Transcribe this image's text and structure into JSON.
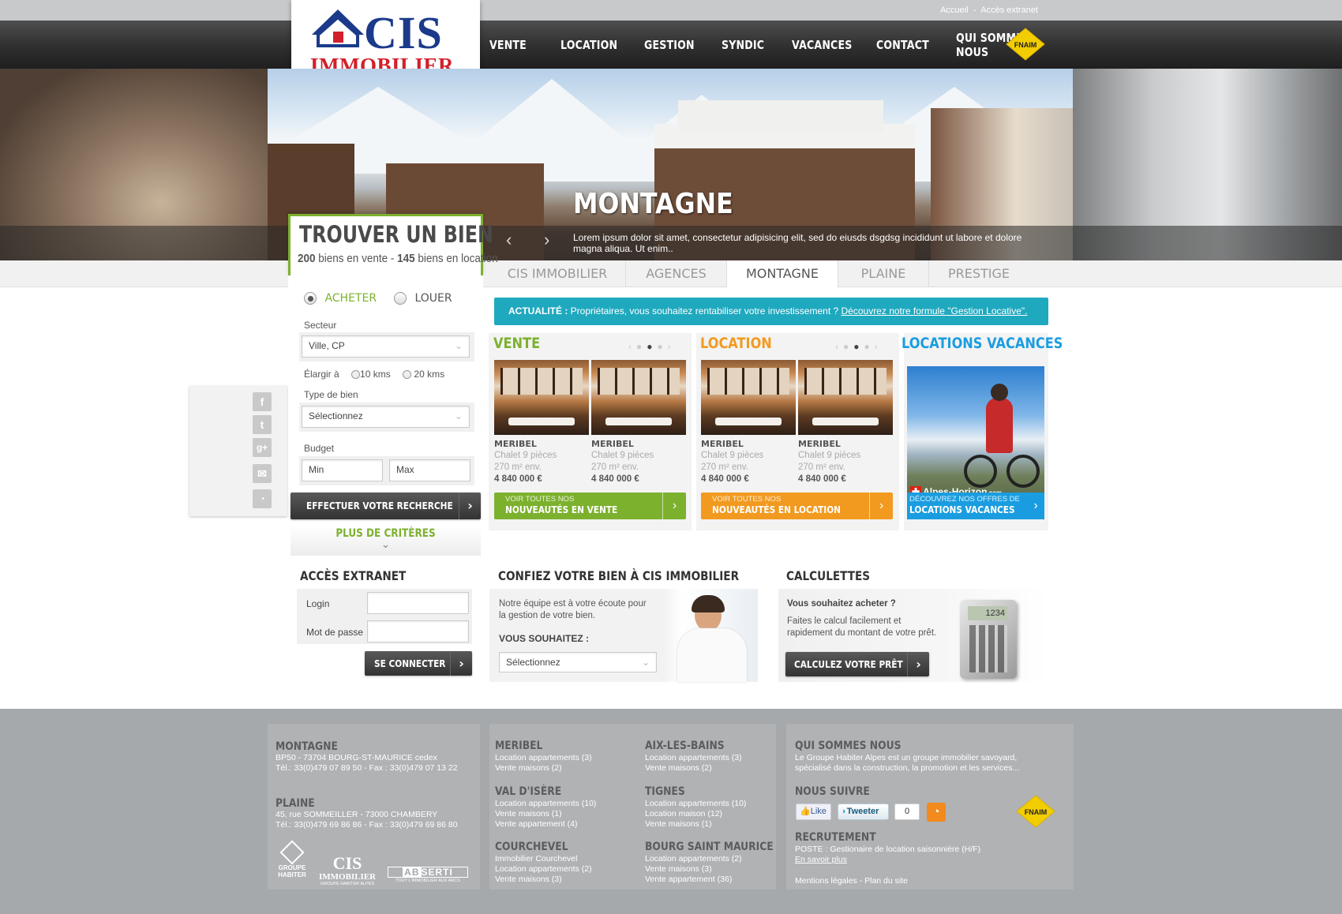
{
  "toplinks": {
    "accueil": "Accueil",
    "sep": "-",
    "extranet": "Accès extranet"
  },
  "logo": {
    "line1": "CIS",
    "line2": "IMMOBILIER"
  },
  "nav": [
    "VENTE",
    "LOCATION",
    "GESTION",
    "SYNDIC",
    "VACANCES",
    "CONTACT",
    "QUI SOMMES NOUS"
  ],
  "fnaim": "FNAIM",
  "hero": {
    "title": "MONTAGNE",
    "text": "Lorem ipsum dolor sit amet, consectetur adipisicing elit, sed do eiusds dsgdsg incididunt ut labore et dolore magna aliqua. Ut enim..",
    "prev": "‹",
    "next": "›"
  },
  "tabs": [
    "CIS IMMOBILIER",
    "AGENCES",
    "MONTAGNE",
    "PLAINE",
    "PRESTIGE"
  ],
  "search": {
    "title": "TROUVER UN BIEN",
    "count_sale": "200",
    "sale_text": " biens en vente - ",
    "count_rent": "145",
    "rent_text": " biens en location",
    "buy": "ACHETER",
    "rent": "LOUER",
    "sector_label": "Secteur",
    "sector_value": "Ville, CP",
    "widen_label": "Élargir à",
    "km10": "10 kms",
    "km20": "20 kms",
    "type_label": "Type de bien",
    "type_value": "Sélectionnez",
    "budget_label": "Budget",
    "min": "Min",
    "max": "Max",
    "submit": "EFFECTUER VOTRE RECHERCHE",
    "more": "PLUS DE CRITÈRES"
  },
  "actu": {
    "label": "ACTUALITÉ :",
    "text": " Propriétaires, vous souhaitez rentabiliser votre investissement ? ",
    "link": "Découvrez notre formule \"Gestion Locative\"."
  },
  "vente": {
    "title": "VENTE",
    "items": [
      {
        "city": "MERIBEL",
        "type": "Chalet 9 pièces",
        "area": "270 m² env.",
        "price": "4 840 000 €"
      },
      {
        "city": "MERIBEL",
        "type": "Chalet 9 pièces",
        "area": "270 m² env.",
        "price": "4 840 000 €"
      }
    ],
    "btn_small": "VOIR TOUTES NOS",
    "btn_big": "NOUVEAUTÉS EN VENTE"
  },
  "location": {
    "title": "LOCATION",
    "items": [
      {
        "city": "MERIBEL",
        "type": "Chalet 9 pièces",
        "area": "270 m² env.",
        "price": "4 840 000 €"
      },
      {
        "city": "MERIBEL",
        "type": "Chalet 9 pièces",
        "area": "270 m² env.",
        "price": "4 840 000 €"
      }
    ],
    "btn_small": "VOIR TOUTES NOS",
    "btn_big": "NOUVEAUTÉS EN LOCATION"
  },
  "vacances": {
    "title": "LOCATIONS VACANCES",
    "brand": "Alpes-Horizon",
    "brand_suffix": ".com",
    "btn_small": "DÉCOUVREZ NOS OFFRES DE",
    "btn_big": "LOCATIONS VACANCES"
  },
  "extranet": {
    "title": "ACCÈS EXTRANET",
    "login": "Login",
    "password": "Mot de passe",
    "submit": "SE CONNECTER"
  },
  "confiez": {
    "title": "CONFIEZ VOTRE BIEN À CIS IMMOBILIER",
    "text": "Notre équipe est à votre écoute pour la gestion de votre bien.",
    "ask": "VOUS SOUHAITEZ :",
    "select": "Sélectionnez"
  },
  "calc": {
    "title": "CALCULETTES",
    "q": "Vous souhaitez acheter ?",
    "text": "Faites le calcul facilement et rapidement du montant de votre prêt.",
    "btn": "CALCULEZ VOTRE PRÊT",
    "display": "1234"
  },
  "footer": {
    "montagne": {
      "title": "MONTAGNE",
      "l1": "BP50 - 73704 BOURG-ST-MAURICE cedex",
      "l2": "Tél.: 33(0)479 07 89 50 - Fax : 33(0)479 07 13 22"
    },
    "plaine": {
      "title": "PLAINE",
      "l1": "45, rue SOMMEILLER - 73000 CHAMBERY",
      "l2": "Tél.: 33(0)479 69 86 86 - Fax : 33(0)479 69 86 80"
    },
    "logos": {
      "g1": "GROUPE",
      "g2": "HABITER",
      "cis": "CIS",
      "cisi": "IMMOBILIER",
      "cisg": "GROUPE HABITER ALPES",
      "ab": "AB",
      "serti": "SERTI",
      "abs": "TOUT L'IMMOBILIER AUX ARCS"
    },
    "cities": [
      {
        "title": "MERIBEL",
        "lines": [
          "Location appartements (3)",
          "Vente maisons (2)"
        ]
      },
      {
        "title": "VAL D'ISÈRE",
        "lines": [
          "Location appartements (10)",
          "Vente maisons (1)",
          "Vente appartement (4)"
        ]
      },
      {
        "title": "COURCHEVEL",
        "lines": [
          "Immobilier Courchevel",
          "Location appartements (2)",
          "Vente maisons (3)"
        ]
      },
      {
        "title": "AIX-LES-BAINS",
        "lines": [
          "Location appartements (3)",
          "Vente maisons (2)"
        ]
      },
      {
        "title": "TIGNES",
        "lines": [
          "Location appartements (10)",
          "Location maison (12)",
          "Vente maisons (1)"
        ]
      },
      {
        "title": "BOURG SAINT MAURICE",
        "lines": [
          "Location appartements (2)",
          "Vente maisons (3)",
          "Vente appartement (36)"
        ]
      }
    ],
    "qui": {
      "title": "QUI SOMMES NOUS",
      "l1": "Le Groupe Habiter Alpes est un groupe immobilier savoyard,",
      "l2": "spécialisé dans la construction, la promotion et les services..."
    },
    "suivre": {
      "title": "NOUS SUIVRE",
      "like": "Like",
      "tweet": "Tweeter",
      "count": "0"
    },
    "recrut": {
      "title": "RECRUTEMENT",
      "poste": "POSTE : Gestionaire de location saisonnière (H/F)",
      "more": "En savoir plus"
    },
    "legal": "Mentions légales - Plan du site"
  }
}
